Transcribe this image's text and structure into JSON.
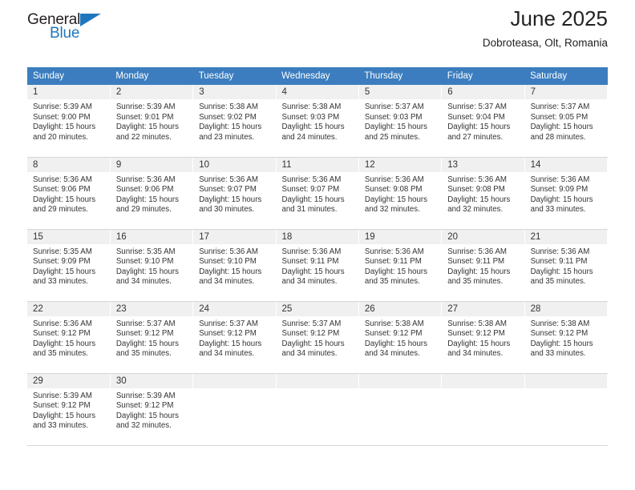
{
  "brand": {
    "line1": "General",
    "line2": "Blue",
    "triangle_color": "#1f76bc"
  },
  "header": {
    "title": "June 2025",
    "location": "Dobroteasa, Olt, Romania",
    "accent_color": "#3b7dbf"
  },
  "weekday_headers": [
    "Sunday",
    "Monday",
    "Tuesday",
    "Wednesday",
    "Thursday",
    "Friday",
    "Saturday"
  ],
  "labels": {
    "sunrise": "Sunrise:",
    "sunset": "Sunset:",
    "daylight": "Daylight:"
  },
  "weeks": [
    [
      {
        "day": "1",
        "sunrise": "Sunrise: 5:39 AM",
        "sunset": "Sunset: 9:00 PM",
        "daylight_l1": "Daylight: 15 hours",
        "daylight_l2": "and 20 minutes."
      },
      {
        "day": "2",
        "sunrise": "Sunrise: 5:39 AM",
        "sunset": "Sunset: 9:01 PM",
        "daylight_l1": "Daylight: 15 hours",
        "daylight_l2": "and 22 minutes."
      },
      {
        "day": "3",
        "sunrise": "Sunrise: 5:38 AM",
        "sunset": "Sunset: 9:02 PM",
        "daylight_l1": "Daylight: 15 hours",
        "daylight_l2": "and 23 minutes."
      },
      {
        "day": "4",
        "sunrise": "Sunrise: 5:38 AM",
        "sunset": "Sunset: 9:03 PM",
        "daylight_l1": "Daylight: 15 hours",
        "daylight_l2": "and 24 minutes."
      },
      {
        "day": "5",
        "sunrise": "Sunrise: 5:37 AM",
        "sunset": "Sunset: 9:03 PM",
        "daylight_l1": "Daylight: 15 hours",
        "daylight_l2": "and 25 minutes."
      },
      {
        "day": "6",
        "sunrise": "Sunrise: 5:37 AM",
        "sunset": "Sunset: 9:04 PM",
        "daylight_l1": "Daylight: 15 hours",
        "daylight_l2": "and 27 minutes."
      },
      {
        "day": "7",
        "sunrise": "Sunrise: 5:37 AM",
        "sunset": "Sunset: 9:05 PM",
        "daylight_l1": "Daylight: 15 hours",
        "daylight_l2": "and 28 minutes."
      }
    ],
    [
      {
        "day": "8",
        "sunrise": "Sunrise: 5:36 AM",
        "sunset": "Sunset: 9:06 PM",
        "daylight_l1": "Daylight: 15 hours",
        "daylight_l2": "and 29 minutes."
      },
      {
        "day": "9",
        "sunrise": "Sunrise: 5:36 AM",
        "sunset": "Sunset: 9:06 PM",
        "daylight_l1": "Daylight: 15 hours",
        "daylight_l2": "and 29 minutes."
      },
      {
        "day": "10",
        "sunrise": "Sunrise: 5:36 AM",
        "sunset": "Sunset: 9:07 PM",
        "daylight_l1": "Daylight: 15 hours",
        "daylight_l2": "and 30 minutes."
      },
      {
        "day": "11",
        "sunrise": "Sunrise: 5:36 AM",
        "sunset": "Sunset: 9:07 PM",
        "daylight_l1": "Daylight: 15 hours",
        "daylight_l2": "and 31 minutes."
      },
      {
        "day": "12",
        "sunrise": "Sunrise: 5:36 AM",
        "sunset": "Sunset: 9:08 PM",
        "daylight_l1": "Daylight: 15 hours",
        "daylight_l2": "and 32 minutes."
      },
      {
        "day": "13",
        "sunrise": "Sunrise: 5:36 AM",
        "sunset": "Sunset: 9:08 PM",
        "daylight_l1": "Daylight: 15 hours",
        "daylight_l2": "and 32 minutes."
      },
      {
        "day": "14",
        "sunrise": "Sunrise: 5:36 AM",
        "sunset": "Sunset: 9:09 PM",
        "daylight_l1": "Daylight: 15 hours",
        "daylight_l2": "and 33 minutes."
      }
    ],
    [
      {
        "day": "15",
        "sunrise": "Sunrise: 5:35 AM",
        "sunset": "Sunset: 9:09 PM",
        "daylight_l1": "Daylight: 15 hours",
        "daylight_l2": "and 33 minutes."
      },
      {
        "day": "16",
        "sunrise": "Sunrise: 5:35 AM",
        "sunset": "Sunset: 9:10 PM",
        "daylight_l1": "Daylight: 15 hours",
        "daylight_l2": "and 34 minutes."
      },
      {
        "day": "17",
        "sunrise": "Sunrise: 5:36 AM",
        "sunset": "Sunset: 9:10 PM",
        "daylight_l1": "Daylight: 15 hours",
        "daylight_l2": "and 34 minutes."
      },
      {
        "day": "18",
        "sunrise": "Sunrise: 5:36 AM",
        "sunset": "Sunset: 9:11 PM",
        "daylight_l1": "Daylight: 15 hours",
        "daylight_l2": "and 34 minutes."
      },
      {
        "day": "19",
        "sunrise": "Sunrise: 5:36 AM",
        "sunset": "Sunset: 9:11 PM",
        "daylight_l1": "Daylight: 15 hours",
        "daylight_l2": "and 35 minutes."
      },
      {
        "day": "20",
        "sunrise": "Sunrise: 5:36 AM",
        "sunset": "Sunset: 9:11 PM",
        "daylight_l1": "Daylight: 15 hours",
        "daylight_l2": "and 35 minutes."
      },
      {
        "day": "21",
        "sunrise": "Sunrise: 5:36 AM",
        "sunset": "Sunset: 9:11 PM",
        "daylight_l1": "Daylight: 15 hours",
        "daylight_l2": "and 35 minutes."
      }
    ],
    [
      {
        "day": "22",
        "sunrise": "Sunrise: 5:36 AM",
        "sunset": "Sunset: 9:12 PM",
        "daylight_l1": "Daylight: 15 hours",
        "daylight_l2": "and 35 minutes."
      },
      {
        "day": "23",
        "sunrise": "Sunrise: 5:37 AM",
        "sunset": "Sunset: 9:12 PM",
        "daylight_l1": "Daylight: 15 hours",
        "daylight_l2": "and 35 minutes."
      },
      {
        "day": "24",
        "sunrise": "Sunrise: 5:37 AM",
        "sunset": "Sunset: 9:12 PM",
        "daylight_l1": "Daylight: 15 hours",
        "daylight_l2": "and 34 minutes."
      },
      {
        "day": "25",
        "sunrise": "Sunrise: 5:37 AM",
        "sunset": "Sunset: 9:12 PM",
        "daylight_l1": "Daylight: 15 hours",
        "daylight_l2": "and 34 minutes."
      },
      {
        "day": "26",
        "sunrise": "Sunrise: 5:38 AM",
        "sunset": "Sunset: 9:12 PM",
        "daylight_l1": "Daylight: 15 hours",
        "daylight_l2": "and 34 minutes."
      },
      {
        "day": "27",
        "sunrise": "Sunrise: 5:38 AM",
        "sunset": "Sunset: 9:12 PM",
        "daylight_l1": "Daylight: 15 hours",
        "daylight_l2": "and 34 minutes."
      },
      {
        "day": "28",
        "sunrise": "Sunrise: 5:38 AM",
        "sunset": "Sunset: 9:12 PM",
        "daylight_l1": "Daylight: 15 hours",
        "daylight_l2": "and 33 minutes."
      }
    ],
    [
      {
        "day": "29",
        "sunrise": "Sunrise: 5:39 AM",
        "sunset": "Sunset: 9:12 PM",
        "daylight_l1": "Daylight: 15 hours",
        "daylight_l2": "and 33 minutes."
      },
      {
        "day": "30",
        "sunrise": "Sunrise: 5:39 AM",
        "sunset": "Sunset: 9:12 PM",
        "daylight_l1": "Daylight: 15 hours",
        "daylight_l2": "and 32 minutes."
      },
      {
        "day": "",
        "sunrise": "",
        "sunset": "",
        "daylight_l1": "",
        "daylight_l2": ""
      },
      {
        "day": "",
        "sunrise": "",
        "sunset": "",
        "daylight_l1": "",
        "daylight_l2": ""
      },
      {
        "day": "",
        "sunrise": "",
        "sunset": "",
        "daylight_l1": "",
        "daylight_l2": ""
      },
      {
        "day": "",
        "sunrise": "",
        "sunset": "",
        "daylight_l1": "",
        "daylight_l2": ""
      },
      {
        "day": "",
        "sunrise": "",
        "sunset": "",
        "daylight_l1": "",
        "daylight_l2": ""
      }
    ]
  ]
}
